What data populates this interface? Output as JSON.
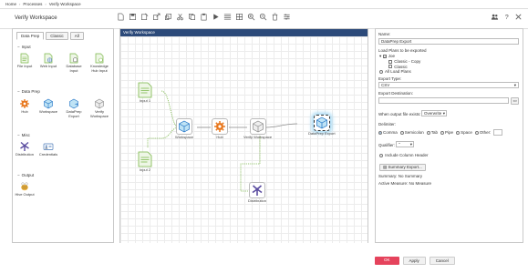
{
  "breadcrumb": [
    "Home",
    "Processes",
    "Verify Workspace"
  ],
  "page_title": "Verify Workspace",
  "toolbar": [
    "new-icon",
    "save-icon",
    "save-as-icon",
    "export-icon",
    "import-icon",
    "cut-icon",
    "copy-icon",
    "paste-icon",
    "play-icon",
    "grid-icon",
    "align-icon",
    "zoom-in-icon",
    "zoom-out-icon",
    "delete-icon",
    "settings-icon"
  ],
  "left": {
    "tabs": [
      "Data Prep",
      "Classic",
      "All"
    ],
    "sections": [
      {
        "title": "Input",
        "tools": [
          "File Input",
          "Web Input",
          "Database Input",
          "Knowledge Hub Input"
        ]
      },
      {
        "title": "Data Prep",
        "tools": [
          "Hub",
          "Workspace",
          "DataPrep Export",
          "Verify Workspace"
        ]
      },
      {
        "title": "Misc",
        "tools": [
          "Distribution",
          "Credentials"
        ]
      },
      {
        "title": "Output",
        "tools": [
          "Hive Output"
        ]
      }
    ]
  },
  "canvas": {
    "title": "Verify Workspace",
    "nodes": {
      "input1": "Input 1",
      "input2": "Input 2",
      "workspace": "Workspace",
      "hub": "Hub",
      "verify": "Verify Workspace",
      "export": "DataPrep Export",
      "distribution": "Distribution"
    }
  },
  "props": {
    "name_label": "Name:",
    "name_value": "DataPrep Export",
    "load_plans_label": "Load Plans to be exported",
    "plan_root": "Joe",
    "plan_children": [
      "Classic - Copy",
      "Classic"
    ],
    "all_load_plans": "All Load Plans",
    "export_type_label": "Export Type:",
    "export_type_value": "CSV",
    "export_dest_label": "Export Destination:",
    "when_exists_label": "When output file exists:",
    "when_exists_value": "Overwrite",
    "delimiter_label": "Delimiter:",
    "delimiters": [
      "Comma",
      "Semicolon",
      "Tab",
      "Pipe",
      "Space",
      "Other:"
    ],
    "qualifier_label": "Qualifier:",
    "qualifier_value": "\"",
    "include_header": "Include Column Header",
    "summary_export_btn": "Summary Export...",
    "summary_label": "Summary:",
    "summary_value": "No Summary",
    "active_measure_label": "Active Measure:",
    "active_measure_value": "No Measure",
    "ok": "OK",
    "apply": "Apply",
    "cancel": "Cancel"
  },
  "colors": {
    "accent": "#1a6fc4",
    "canvas_header": "#2c4a7a",
    "ok": "#e5435c",
    "orange": "#e8781f",
    "green": "#7ab648",
    "purple": "#5b4da0"
  }
}
